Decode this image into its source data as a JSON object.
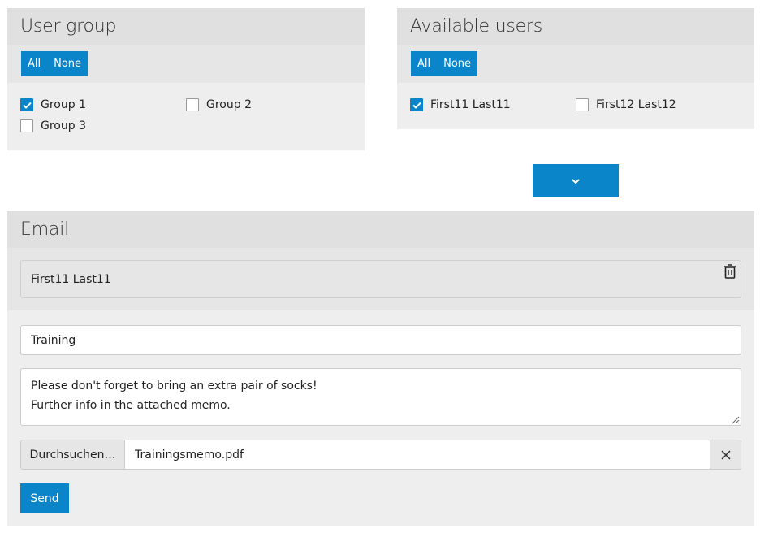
{
  "user_group": {
    "title": "User group",
    "select_all": "All",
    "select_none": "None",
    "items": [
      {
        "label": "Group 1",
        "checked": true
      },
      {
        "label": "Group 2",
        "checked": false
      },
      {
        "label": "Group 3",
        "checked": false
      }
    ]
  },
  "available_users": {
    "title": "Available users",
    "select_all": "All",
    "select_none": "None",
    "items": [
      {
        "label": "First11 Last11",
        "checked": true
      },
      {
        "label": "First12 Last12",
        "checked": false
      }
    ]
  },
  "move_button": {
    "icon": "chevron-down-icon"
  },
  "email": {
    "title": "Email",
    "recipients": [
      {
        "name": "First11 Last11",
        "remove_icon": "trash-icon"
      }
    ],
    "subject": "Training",
    "message_lines": [
      "Please don't forget to bring an extra pair of socks!",
      "Further info in the attached memo."
    ],
    "browse_label": "Durchsuchen…",
    "file_name": "Trainingsmemo.pdf",
    "clear_icon": "close-icon",
    "send_label": "Send"
  },
  "colors": {
    "accent": "#0a85c9",
    "panel_bg": "#eeeeee",
    "header_bg": "#e0e0e0"
  }
}
